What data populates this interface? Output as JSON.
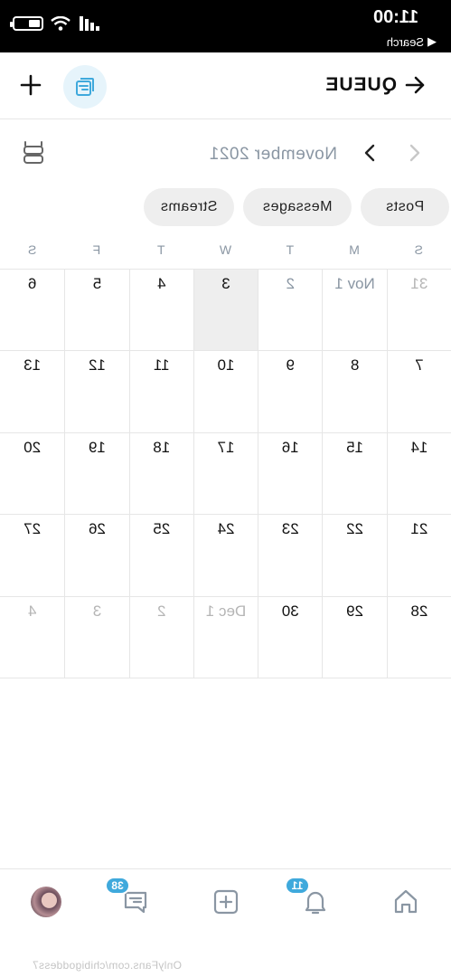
{
  "status_bar": {
    "time": "11:00",
    "back_label": "Search"
  },
  "header": {
    "title": "QUEUE"
  },
  "month_nav": {
    "month_label": "November 2021"
  },
  "filters": {
    "posts": "Posts",
    "messages": "Messages",
    "streams": "Streams"
  },
  "weekdays": [
    "S",
    "M",
    "T",
    "W",
    "T",
    "F",
    "S"
  ],
  "calendar": {
    "weeks": [
      [
        "31",
        "Nov 1",
        "2",
        "3",
        "4",
        "5",
        "6"
      ],
      [
        "7",
        "8",
        "9",
        "10",
        "11",
        "12",
        "13"
      ],
      [
        "14",
        "15",
        "16",
        "17",
        "18",
        "19",
        "20"
      ],
      [
        "21",
        "22",
        "23",
        "24",
        "25",
        "26",
        "27"
      ],
      [
        "28",
        "29",
        "30",
        "Dec 1",
        "2",
        "3",
        "4"
      ]
    ]
  },
  "bottom_nav": {
    "notifications_badge": "11",
    "messages_badge": "38"
  },
  "watermark": "OnlyFans.com/chibigoddess7",
  "colors": {
    "accent": "#3fa9dc",
    "muted_text": "#8a96a3",
    "today_bg": "#eeeeee"
  }
}
